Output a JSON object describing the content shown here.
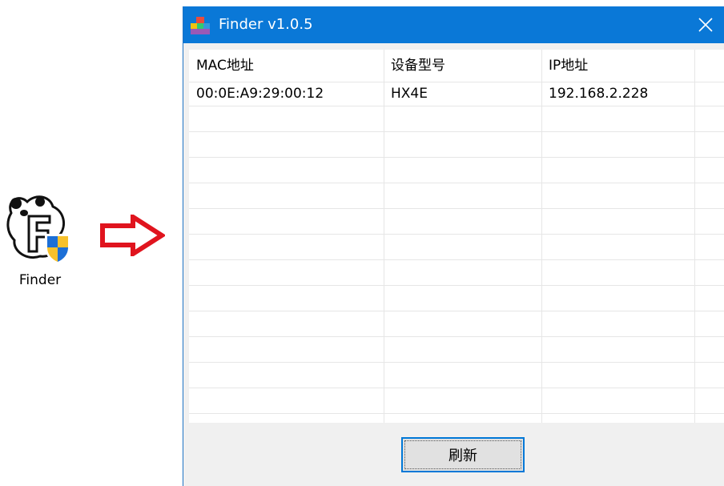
{
  "desktop": {
    "shortcut_label": "Finder",
    "icon": "finder-app-icon",
    "arrow_icon": "right-arrow-icon",
    "arrow_color": "#e0141e"
  },
  "window": {
    "title": "Finder v1.0.5",
    "titlebar_color": "#0a78d7",
    "app_icon": "finder-app-icon",
    "close_icon": "close-icon"
  },
  "device_table": {
    "columns": [
      "MAC地址",
      "设备型号",
      "IP地址"
    ],
    "rows": [
      [
        "00:0E:A9:29:00:12",
        "HX4E",
        "192.168.2.228"
      ]
    ]
  },
  "buttons": {
    "refresh_label": "刷新"
  }
}
